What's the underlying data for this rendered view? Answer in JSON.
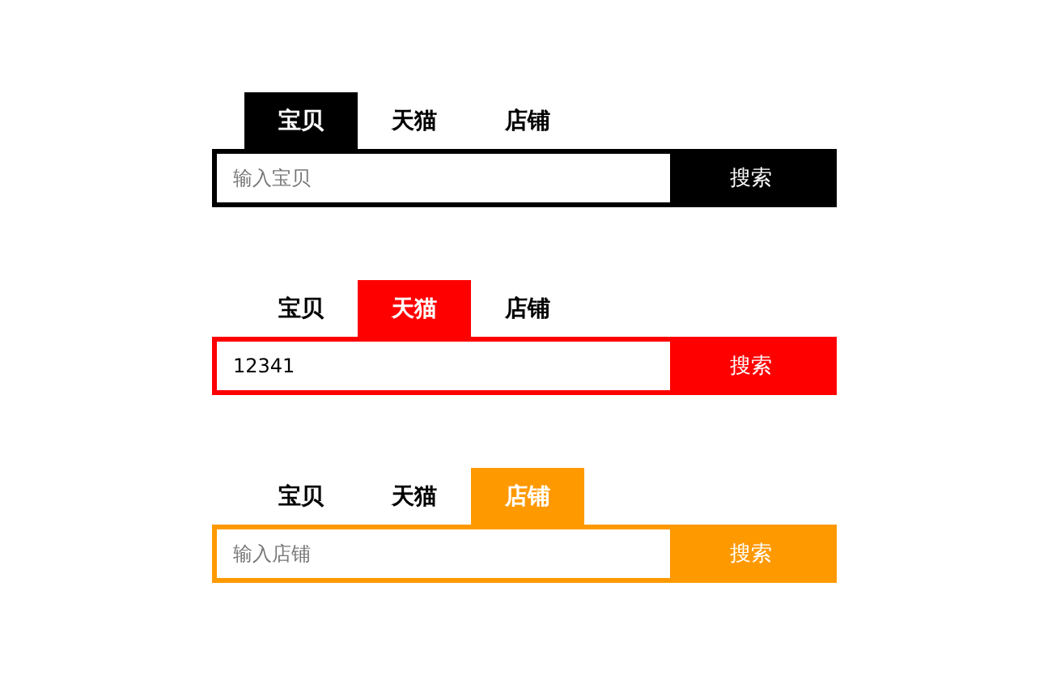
{
  "search_forms": [
    {
      "color": "#000000",
      "tabs": [
        {
          "label": "宝贝",
          "selected": true
        },
        {
          "label": "天猫",
          "selected": false
        },
        {
          "label": "店铺",
          "selected": false
        }
      ],
      "input": {
        "placeholder": "输入宝贝"
      },
      "button": "搜索"
    },
    {
      "color": "#ff0000",
      "tabs": [
        {
          "label": "宝贝",
          "selected": false
        },
        {
          "label": "天猫",
          "selected": true
        },
        {
          "label": "店铺",
          "selected": false
        }
      ],
      "input": {
        "value": "12341"
      },
      "button": "搜索"
    },
    {
      "color": "#ff9900",
      "tabs": [
        {
          "label": "宝贝",
          "selected": false
        },
        {
          "label": "天猫",
          "selected": false
        },
        {
          "label": "店铺",
          "selected": true
        }
      ],
      "input": {
        "placeholder": "输入店铺"
      },
      "button": "搜索"
    }
  ]
}
